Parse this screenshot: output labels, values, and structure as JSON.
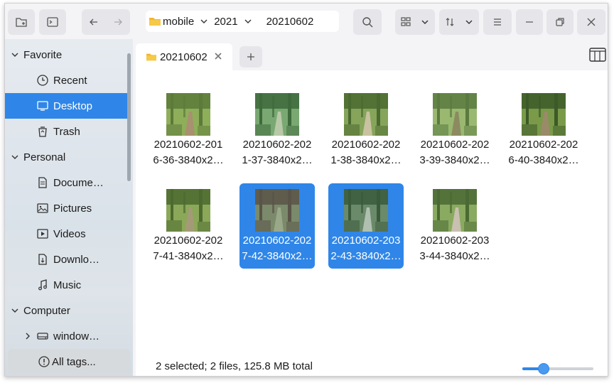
{
  "toolbar": {
    "breadcrumb": [
      "mobile",
      "2021",
      "20210602"
    ]
  },
  "sidebar": {
    "groups": [
      {
        "label": "Favorite",
        "items": [
          {
            "label": "Recent",
            "icon": "clock-icon"
          },
          {
            "label": "Desktop",
            "icon": "monitor-icon",
            "selected": true
          },
          {
            "label": "Trash",
            "icon": "trash-icon"
          }
        ]
      },
      {
        "label": "Personal",
        "items": [
          {
            "label": "Docume…",
            "icon": "document-icon"
          },
          {
            "label": "Pictures",
            "icon": "picture-icon"
          },
          {
            "label": "Videos",
            "icon": "video-icon"
          },
          {
            "label": "Downlo…",
            "icon": "download-icon"
          },
          {
            "label": "Music",
            "icon": "music-icon"
          }
        ]
      },
      {
        "label": "Computer",
        "items": [
          {
            "label": "window…",
            "icon": "drive-icon"
          }
        ]
      }
    ],
    "tags_label": "All tags..."
  },
  "tab": {
    "label": "20210602"
  },
  "files": [
    {
      "line1": "20210602-201",
      "line2": "6-36-3840x2…",
      "selected": false,
      "palette": [
        "#5c7a3a",
        "#8fae5a",
        "#a89070"
      ]
    },
    {
      "line1": "20210602-202",
      "line2": "1-37-3840x2…",
      "selected": false,
      "palette": [
        "#3e6a3c",
        "#7aa872",
        "#b9c9a8"
      ]
    },
    {
      "line1": "20210602-202",
      "line2": "1-38-3840x2…",
      "selected": false,
      "palette": [
        "#4a6a30",
        "#86a45a",
        "#c8c2a0"
      ]
    },
    {
      "line1": "20210602-202",
      "line2": "3-39-3840x2…",
      "selected": false,
      "palette": [
        "#5a7a40",
        "#9ab870",
        "#8c8a60"
      ]
    },
    {
      "line1": "20210602-202",
      "line2": "6-40-3840x2…",
      "selected": false,
      "palette": [
        "#3c5a28",
        "#7a9a4a",
        "#9a8a6a"
      ]
    },
    {
      "line1": "20210602-202",
      "line2": "7-41-3840x2…",
      "selected": false,
      "palette": [
        "#4c6a30",
        "#8aa858",
        "#a49a78"
      ]
    },
    {
      "line1": "20210602-202",
      "line2": "7-42-3840x2…",
      "selected": true,
      "palette": [
        "#5a5448",
        "#7a8a6a",
        "#9aa88a"
      ]
    },
    {
      "line1": "20210602-203",
      "line2": "2-43-3840x2…",
      "selected": true,
      "palette": [
        "#3a5a3c",
        "#6a8a6a",
        "#b0c0b0"
      ]
    },
    {
      "line1": "20210602-203",
      "line2": "3-44-3840x2…",
      "selected": false,
      "palette": [
        "#4a6a34",
        "#8aaa60",
        "#c8c0b0"
      ]
    }
  ],
  "status": {
    "text": "2 selected; 2 files, 125.8 MB total"
  },
  "zoom": {
    "level": 0.3
  },
  "colors": {
    "accent": "#2f86e8",
    "window_bg": "#f4f4f6",
    "content_bg": "#ffffff"
  }
}
